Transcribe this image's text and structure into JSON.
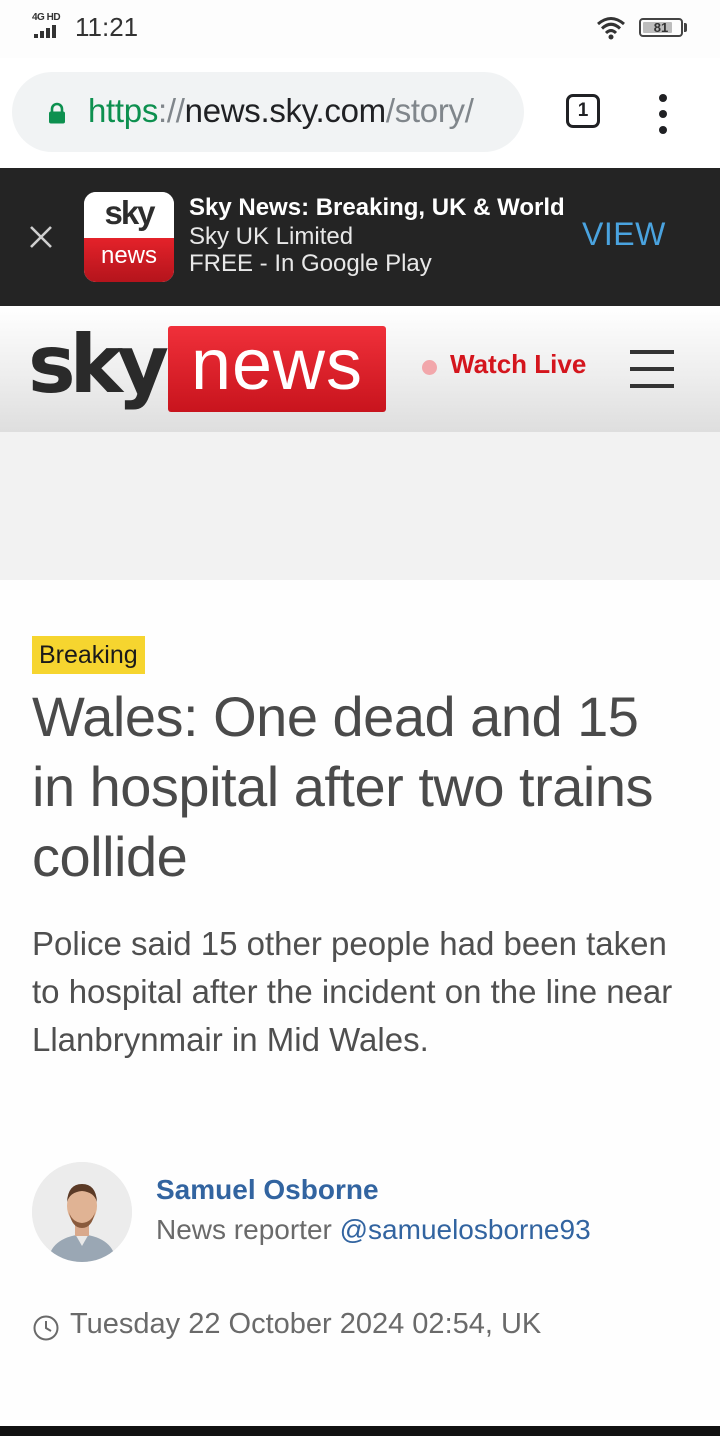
{
  "status_bar": {
    "network": "4G HD",
    "time": "11:21",
    "battery": "81",
    "battery_level": 0.81
  },
  "browser": {
    "url_scheme": "https",
    "url_sep": "://",
    "url_host": "news.sky.com",
    "url_path": "/story/",
    "tab_count": "1"
  },
  "app_banner": {
    "app_icon_top": "sky",
    "app_icon_bottom": "news",
    "title": "Sky News: Breaking, UK & World",
    "developer": "Sky UK Limited",
    "price": "FREE - In Google Play",
    "action": "VIEW",
    "accent_color": "#4aa3df"
  },
  "site_header": {
    "logo_left": "sky",
    "logo_right": "news",
    "watch_live": "Watch Live",
    "brand_color": "#d4151d"
  },
  "article": {
    "badge": "Breaking",
    "badge_color": "#f6d52f",
    "headline": "Wales: One dead and 15 in hospital after two trains collide",
    "standfirst": "Police said 15 other people had been taken to hospital after the incident on the line near Llanbrynmair in Mid Wales.",
    "author_name": "Samuel Osborne",
    "author_role": "News reporter",
    "author_handle": "@samuelosborne93",
    "timestamp": "Tuesday 22 October 2024 02:54, UK"
  },
  "icons": [
    "lock-icon",
    "tabs-icon",
    "menu-icon",
    "close-icon",
    "wifi-icon",
    "battery-icon",
    "hamburger-icon",
    "clock-icon"
  ]
}
